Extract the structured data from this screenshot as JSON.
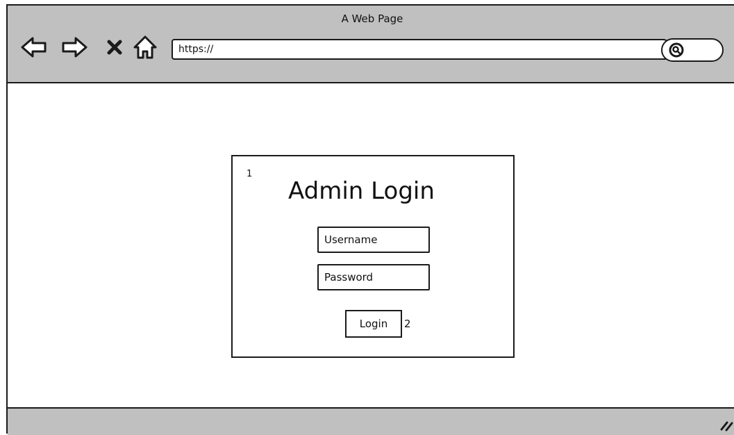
{
  "window": {
    "title": "A Web Page"
  },
  "toolbar": {
    "back_icon": "back-arrow-icon",
    "forward_icon": "forward-arrow-icon",
    "stop_icon": "close-x-icon",
    "home_icon": "home-icon",
    "url_value": "https://",
    "search_icon": "search-icon"
  },
  "login_panel": {
    "marker_1": "1",
    "title": "Admin Login",
    "username_placeholder": "Username",
    "password_placeholder": "Password",
    "login_label": "Login",
    "marker_2": "2"
  },
  "statusbar": {
    "resize_icon": "resize-grip-icon"
  },
  "colors": {
    "chrome": "#c0c0c0",
    "stroke": "#1a1a1a",
    "background": "#ffffff"
  }
}
